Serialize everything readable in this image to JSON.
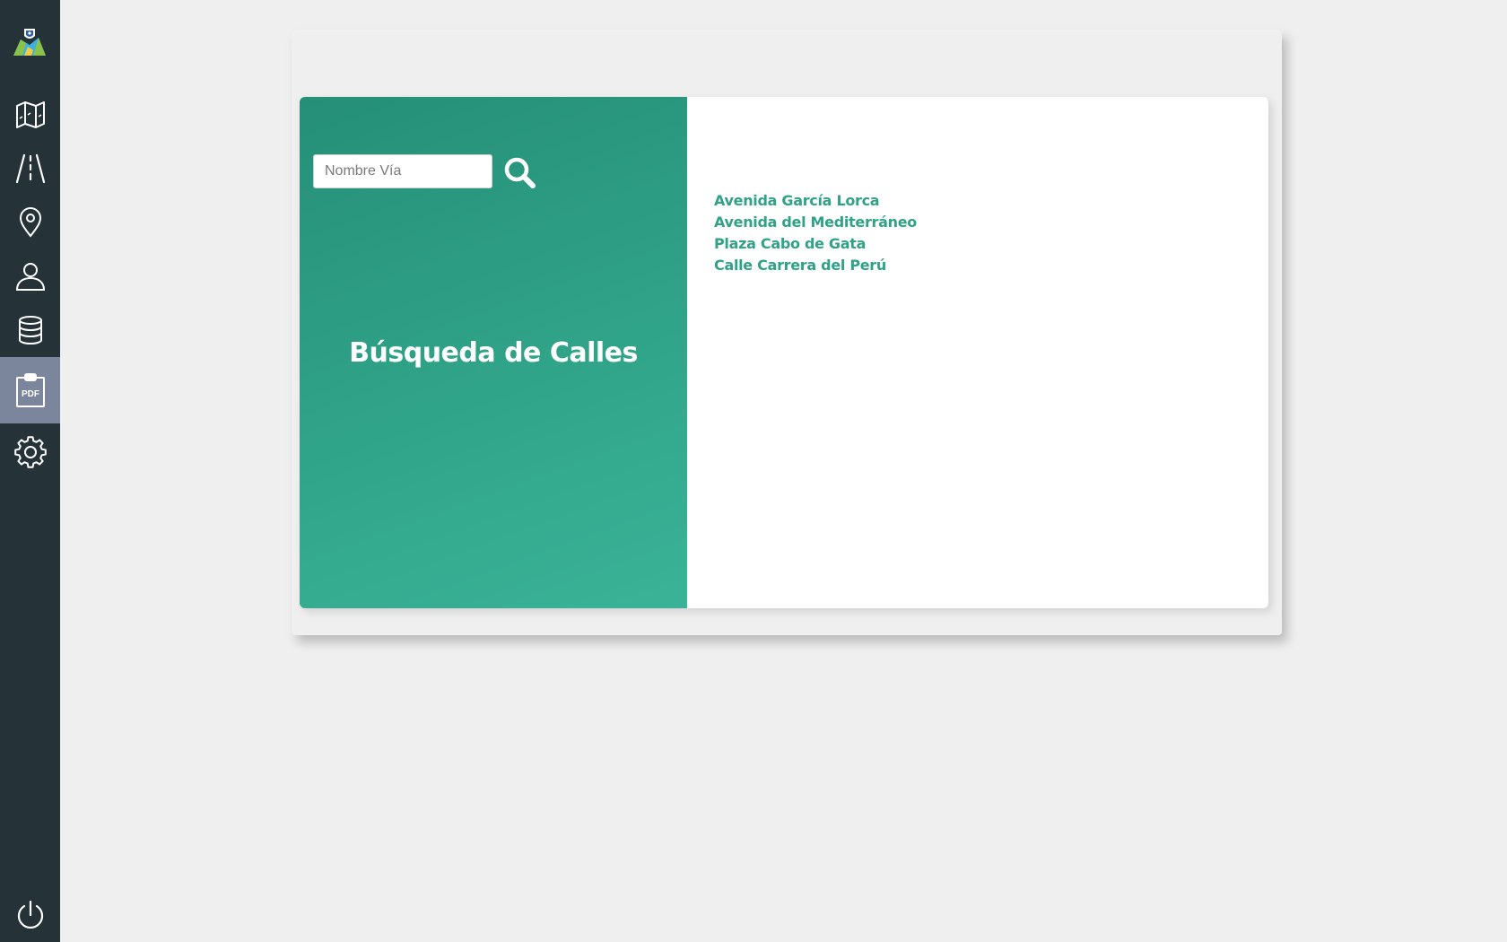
{
  "sidebar": {
    "logo": "app-logo",
    "items": [
      {
        "icon": "map-icon",
        "active": false
      },
      {
        "icon": "road-icon",
        "active": false
      },
      {
        "icon": "location-pin-icon",
        "active": false
      },
      {
        "icon": "user-icon",
        "active": false
      },
      {
        "icon": "database-icon",
        "active": false
      },
      {
        "icon": "pdf-clipboard-icon",
        "active": true,
        "badge": "PDF"
      },
      {
        "icon": "gear-icon",
        "active": false
      }
    ],
    "power_icon": "power-icon"
  },
  "search": {
    "placeholder": "Nombre Vía",
    "value": "",
    "button_icon": "search-icon"
  },
  "panel": {
    "title": "Búsqueda de Calles"
  },
  "results": [
    "Avenida García Lorca",
    "Avenida del Mediterráneo",
    "Plaza Cabo de Gata",
    "Calle Carrera del Perú"
  ],
  "colors": {
    "sidebar_bg": "#253238",
    "sidebar_active": "#7b869c",
    "accent": "#2fa287",
    "background": "#efefef"
  }
}
